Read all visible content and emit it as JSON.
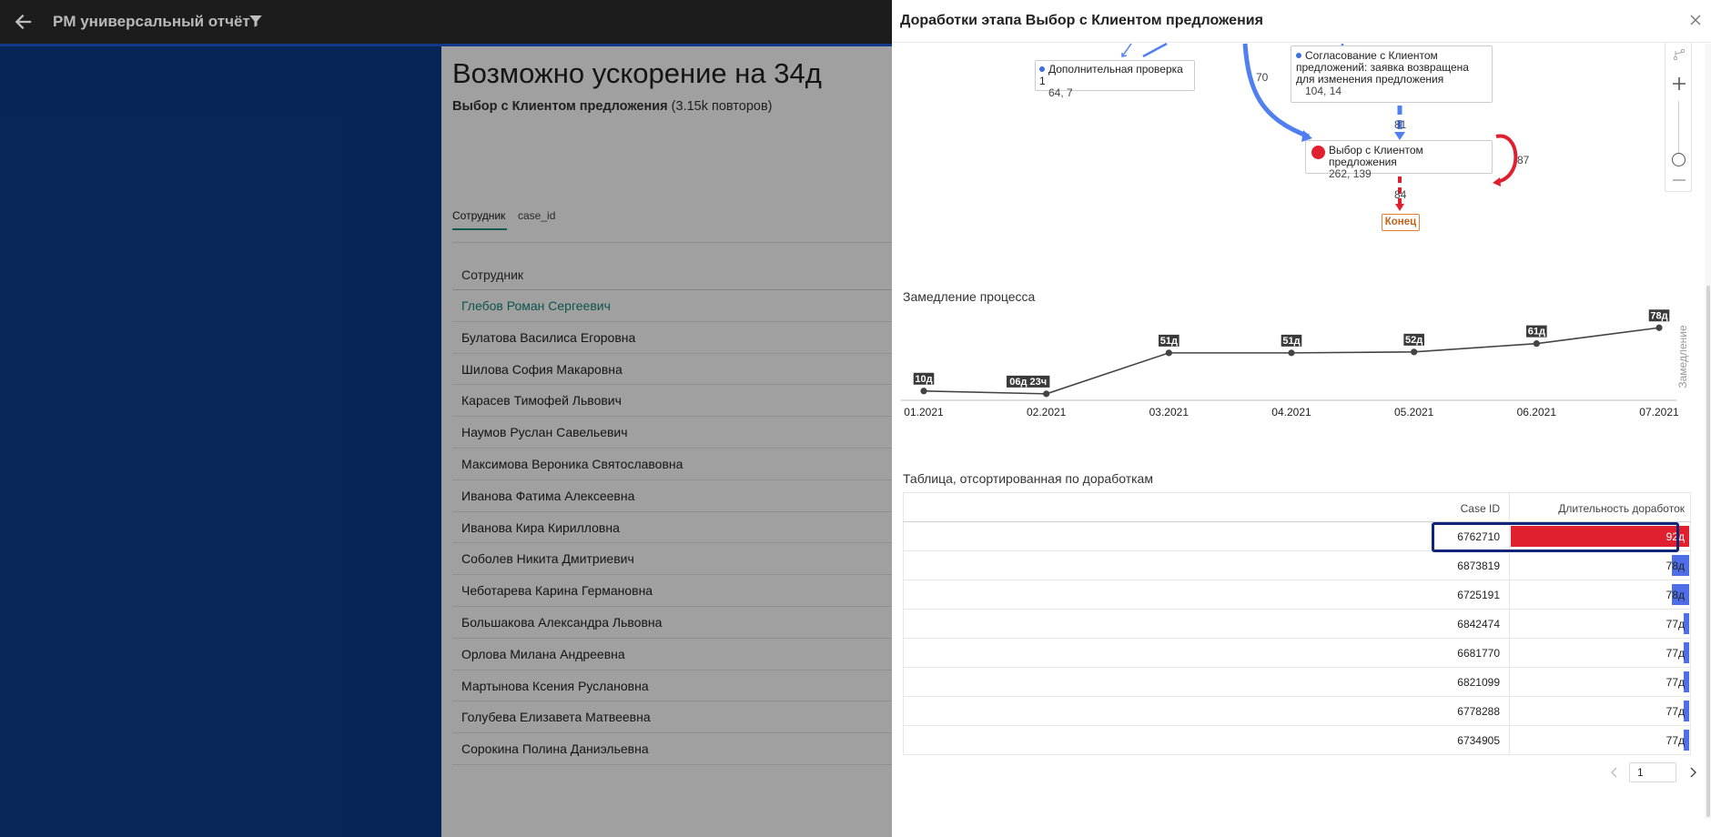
{
  "topbar": {
    "title": "PM универсальный отчёт",
    "back_icon": "arrow-left-icon",
    "filter_icon": "filter-icon"
  },
  "report": {
    "headline": "Возможно ускорение на 34д",
    "activity": "Выбор с Клиентом предложения",
    "repeats": "(3.15k повторов)",
    "tabs": [
      {
        "label": "Сотрудник",
        "active": true
      },
      {
        "label": "case_id",
        "active": false
      }
    ],
    "table_header": "Сотрудник",
    "employees": [
      "Глебов Роман Сергеевич",
      "Булатова Василиса Егоровна",
      "Шилова София Макаровна",
      "Карасев Тимофей Львович",
      "Наумов Руслан Савельевич",
      "Максимова Вероника Святославовна",
      "Иванова Фатима Алексеевна",
      "Иванова Кира Кирилловна",
      "Соболев Никита Дмитриевич",
      "Чеботарева Карина Германовна",
      "Большакова Александра Львовна",
      "Орлова Милана Андреевна",
      "Мартынова Ксения Руслановна",
      "Голубева Елизавета Матвеевна",
      "Сорокина Полина Даниэльевна"
    ]
  },
  "drawer": {
    "title": "Доработки этапа Выбор с Клиентом предложения",
    "close_icon": "close-icon",
    "process_map": {
      "node_check": {
        "label": "Дополнительная проверка 1",
        "stats": "64, 7"
      },
      "node_approval": {
        "label": "Согласование с Клиентом предложений: заявка возвращена для изменения предложения",
        "stats": "104, 14"
      },
      "node_choice": {
        "label": "Выбор с Клиентом предложения",
        "stats": "262, 139"
      },
      "end_label": "Конец",
      "edge_labels": {
        "curve": "70",
        "approval_to_choice": "81",
        "loop": "87",
        "choice_to_end": "84"
      },
      "colors": {
        "edge_blue": "#4f7ff0",
        "edge_red": "#e0202e",
        "end_orange": "#e57f2e"
      },
      "controls": [
        "branch-icon",
        "zoom-in-icon",
        "zoom-slider",
        "zoom-out-icon"
      ]
    },
    "slowdown": {
      "title": "Замедление процесса",
      "y_label": "Замедление"
    },
    "cases_table": {
      "title": "Таблица, отсортированная по доработкам",
      "headers": {
        "case_id": "Case ID",
        "duration": "Длительность доработок"
      },
      "rows": [
        {
          "id": "6762710",
          "duration": "92д",
          "value": 92,
          "selected": true
        },
        {
          "id": "6873819",
          "duration": "78д",
          "value": 78,
          "selected": false
        },
        {
          "id": "6725191",
          "duration": "78д",
          "value": 78,
          "selected": false
        },
        {
          "id": "6842474",
          "duration": "77д",
          "value": 77,
          "selected": false
        },
        {
          "id": "6681770",
          "duration": "77д",
          "value": 77,
          "selected": false
        },
        {
          "id": "6821099",
          "duration": "77д",
          "value": 77,
          "selected": false
        },
        {
          "id": "6778288",
          "duration": "77д",
          "value": 77,
          "selected": false
        },
        {
          "id": "6734905",
          "duration": "77д",
          "value": 77,
          "selected": false
        }
      ],
      "colors": {
        "selected_bar": "#e0202e",
        "bar": "#4f6fe8",
        "selection_border": "#12237a"
      }
    },
    "pagination": {
      "page": "1"
    }
  },
  "chart_data": {
    "type": "line",
    "title": "Замедление процесса",
    "ylabel": "Замедление",
    "xlabel": "",
    "categories": [
      "01.2021",
      "02.2021",
      "03.2021",
      "04.2021",
      "05.2021",
      "06.2021",
      "07.2021"
    ],
    "values_days": [
      10,
      6.96,
      51,
      51,
      52,
      61,
      78
    ],
    "labels": [
      "10д",
      "06д 23ч",
      "51д",
      "51д",
      "52д",
      "61д",
      "78д"
    ],
    "ylim": [
      0,
      90
    ],
    "grid": false,
    "color": "#444444"
  }
}
